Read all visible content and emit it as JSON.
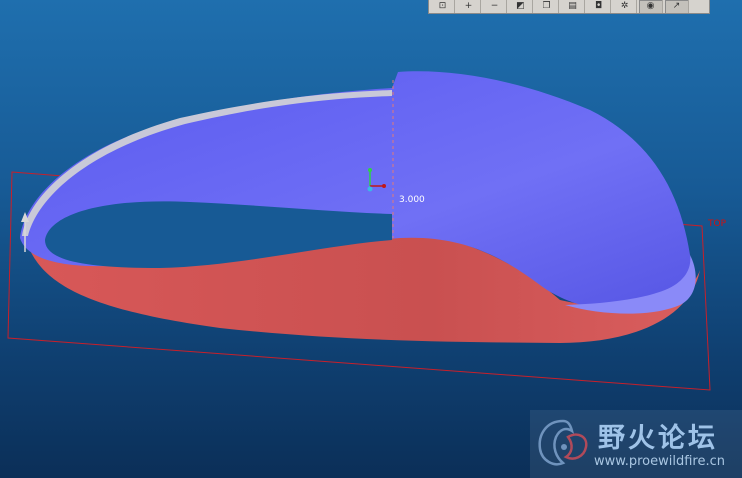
{
  "toolbar": {
    "buttons": [
      {
        "id": "zoom-window",
        "glyph": "⊡"
      },
      {
        "id": "zoom-in",
        "glyph": "+"
      },
      {
        "id": "zoom-out",
        "glyph": "−"
      },
      {
        "id": "repaint",
        "glyph": "◩"
      },
      {
        "id": "saved-views",
        "glyph": "❐"
      },
      {
        "id": "layers",
        "glyph": "▤"
      },
      {
        "id": "camera",
        "glyph": "◘"
      },
      {
        "id": "spin-center",
        "glyph": "✲"
      },
      {
        "id": "view-display",
        "glyph": "◉"
      },
      {
        "id": "sketch",
        "glyph": "↗"
      }
    ]
  },
  "model": {
    "dimension_value": "3.000",
    "datum_plane_label": "TOP",
    "colors": {
      "surface_blue": "#6b6cf0",
      "surface_red": "#d45a5a",
      "datum_red": "#c8202a",
      "background_top": "#1f6fae",
      "background_bottom": "#0b2f58"
    }
  },
  "watermark": {
    "title": "野火论坛",
    "url": "www.proewildfire.cn"
  }
}
